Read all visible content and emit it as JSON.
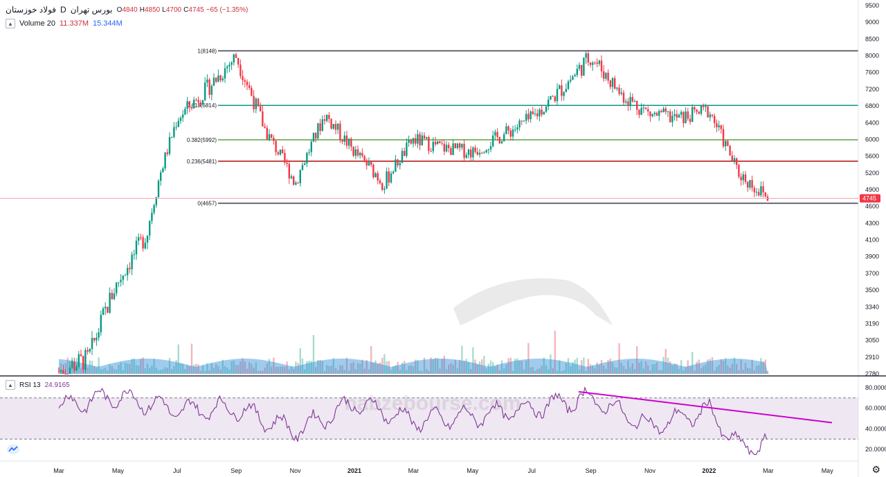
{
  "header": {
    "symbol_title": "فولاد خوزستان",
    "interval": "D",
    "exchange": "بورس تهران",
    "o_label": "O",
    "o": "4840",
    "h_label": "H",
    "h": "4850",
    "l_label": "L",
    "l": "4700",
    "c_label": "C",
    "c": "4745",
    "change": "−65 (−1.35%)"
  },
  "volume_legend": {
    "label": "Volume 20",
    "v1": "11.337M",
    "v2": "15.344M"
  },
  "rsi_legend": {
    "label": "RSI 13",
    "value": "24.9165"
  },
  "price_axis": [
    "9500",
    "9000",
    "8500",
    "8000",
    "7600",
    "7200",
    "6800",
    "6400",
    "6000",
    "5600",
    "5200",
    "4900",
    "4600",
    "4300",
    "4100",
    "3900",
    "3700",
    "3500",
    "3340",
    "3190",
    "3050",
    "2910",
    "2780"
  ],
  "rsi_axis": [
    "80.0000",
    "60.0000",
    "40.0000",
    "20.0000"
  ],
  "last_price": "4745",
  "time_axis": [
    "Mar",
    "May",
    "Jul",
    "Sep",
    "Nov",
    "2021",
    "Mar",
    "May",
    "Jul",
    "Sep",
    "Nov",
    "2022",
    "Mar",
    "May"
  ],
  "fib_levels": [
    {
      "label": "1(8148)",
      "color": "#434651",
      "price": 8148
    },
    {
      "label": "0.618(6814)",
      "color": "#089981",
      "price": 6814
    },
    {
      "label": "0.382(5992)",
      "color": "#6aa84f",
      "price": 5992
    },
    {
      "label": "0.236(5481)",
      "color": "#b71c1c",
      "price": 5481
    },
    {
      "label": "0(4657)",
      "color": "#434651",
      "price": 4657
    }
  ],
  "watermark": {
    "text": "nabzebourse.com"
  },
  "colors": {
    "up": "#089981",
    "down": "#f23645",
    "rsi": "#7e3794",
    "trend": "#cc00cc",
    "volume_ma": "#2a8fd8"
  },
  "chart_data": {
    "type": "candlestick",
    "interval": "D",
    "last_bar": {
      "open": 4840,
      "high": 4850,
      "low": 4700,
      "close": 4745
    },
    "close_trend": {
      "x": [
        "2020-03",
        "2020-04",
        "2020-05",
        "2020-06",
        "2020-07",
        "2020-08",
        "2020-09",
        "2020-10",
        "2020-11",
        "2020-12",
        "2021-01",
        "2021-02",
        "2021-03",
        "2021-04",
        "2021-05",
        "2021-06",
        "2021-07",
        "2021-08",
        "2021-09",
        "2021-10",
        "2021-11",
        "2021-12",
        "2022-01",
        "2022-02",
        "2022-03"
      ],
      "y": [
        2800,
        2900,
        3600,
        4200,
        6500,
        7200,
        8000,
        6200,
        5000,
        6600,
        5700,
        5000,
        6000,
        5800,
        5700,
        6100,
        6500,
        7200,
        8000,
        7100,
        6600,
        6500,
        6700,
        5200,
        4745
      ]
    },
    "rsi": {
      "x": [
        "2020-03",
        "2020-05",
        "2020-07",
        "2020-09",
        "2020-11",
        "2021-01",
        "2021-03",
        "2021-05",
        "2021-07",
        "2021-09",
        "2021-11",
        "2022-01",
        "2022-02",
        "2022-03"
      ],
      "y": [
        62,
        72,
        58,
        60,
        38,
        65,
        48,
        52,
        60,
        70,
        42,
        58,
        22,
        25
      ],
      "overbought": 70,
      "oversold": 30
    }
  }
}
